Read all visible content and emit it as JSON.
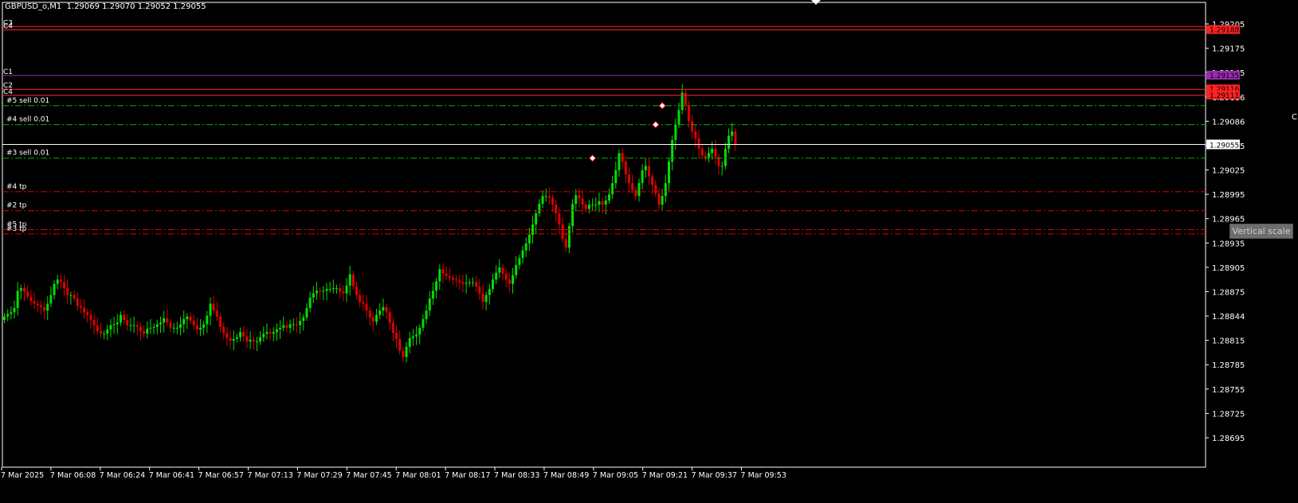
{
  "title": "GBPUSD_o,M1  1.29069 1.29070 1.29052 1.29055",
  "tooltip": "Vertical scale",
  "edge_button_glyph": "C",
  "colors": {
    "background": "#000000",
    "frame": "#ffffff",
    "bull": "#00e000",
    "bear": "#e00000",
    "level_red": "#ff2222",
    "level_purple": "#9a2bb0",
    "sell_line": "#00b300",
    "tp_line": "#e00000",
    "bid_line": "#ffffff",
    "grid_text": "#ffffff"
  },
  "chart_data": {
    "type": "candlestick",
    "symbol": "GBPUSD_o",
    "timeframe": "M1",
    "ohlc_last": {
      "open": 1.29069,
      "high": 1.2907,
      "low": 1.29052,
      "close": 1.29055
    },
    "ylim": [
      1.2868,
      1.2922
    ],
    "price_ticks": [
      "1.29205",
      "1.29175",
      "1.29145",
      "1.29116",
      "1.29086",
      "1.29055",
      "1.29025",
      "1.28995",
      "1.28965",
      "1.28935",
      "1.28905",
      "1.28875",
      "1.28844",
      "1.28815",
      "1.28785",
      "1.28755",
      "1.28725",
      "1.28695"
    ],
    "time_ticks": [
      "7 Mar 2025",
      "7 Mar 06:08",
      "7 Mar 06:24",
      "7 Mar 06:41",
      "7 Mar 06:57",
      "7 Mar 07:13",
      "7 Mar 07:29",
      "7 Mar 07:45",
      "7 Mar 08:01",
      "7 Mar 08:17",
      "7 Mar 08:33",
      "7 Mar 08:49",
      "7 Mar 09:05",
      "7 Mar 09:21",
      "7 Mar 09:37",
      "7 Mar 09:53"
    ],
    "bid": {
      "price": 1.29055,
      "label": "1.29055"
    },
    "levels": [
      {
        "name": "C3",
        "price": 1.29192,
        "color": "red"
      },
      {
        "name": "C4",
        "price": 1.29188,
        "color": "red",
        "tag": "1.29188"
      },
      {
        "name": "C1",
        "price": 1.29135,
        "color": "purple",
        "tag": "1.29135"
      },
      {
        "name": "C2",
        "price": 1.29119,
        "color": "red",
        "tag": "1.29116"
      },
      {
        "name": "C4",
        "price": 1.29112,
        "color": "red",
        "tag": "1.29111"
      }
    ],
    "orders": [
      {
        "label": "#5 sell 0.01",
        "price": 1.291
      },
      {
        "label": "#4 sell 0.01",
        "price": 1.29078
      },
      {
        "label": "#3 sell 0.01",
        "price": 1.29039
      }
    ],
    "take_profits": [
      {
        "label": "#4 tp",
        "price": 1.29
      },
      {
        "label": "#2 tp",
        "price": 1.28978
      },
      {
        "label": "#5 tp",
        "price": 1.28956
      },
      {
        "label": "#3 tp",
        "price": 1.28951
      }
    ],
    "entries": [
      {
        "index": 177,
        "price": 1.29039
      },
      {
        "index": 196,
        "price": 1.29078
      },
      {
        "index": 198,
        "price": 1.291
      }
    ],
    "closes": [
      1.28855,
      1.28858,
      1.2886,
      1.28865,
      1.28885,
      1.28888,
      1.28884,
      1.28878,
      1.28873,
      1.2887,
      1.28868,
      1.28866,
      1.28862,
      1.2887,
      1.2888,
      1.28893,
      1.28898,
      1.28895,
      1.28888,
      1.2888,
      1.2888,
      1.28876,
      1.28867,
      1.28865,
      1.2886,
      1.28857,
      1.28851,
      1.28845,
      1.28838,
      1.28835,
      1.28835,
      1.2884,
      1.28845,
      1.28846,
      1.28848,
      1.28857,
      1.28851,
      1.28845,
      1.28845,
      1.28845,
      1.28843,
      1.28838,
      1.28835,
      1.28841,
      1.28842,
      1.28843,
      1.28846,
      1.28848,
      1.28853,
      1.28848,
      1.28842,
      1.28842,
      1.28842,
      1.28846,
      1.28852,
      1.28855,
      1.2885,
      1.28845,
      1.2884,
      1.28842,
      1.28846,
      1.28856,
      1.2887,
      1.28862,
      1.28855,
      1.28843,
      1.28836,
      1.2883,
      1.28827,
      1.28829,
      1.28831,
      1.28837,
      1.28832,
      1.28826,
      1.28828,
      1.28826,
      1.28826,
      1.28831,
      1.28835,
      1.28837,
      1.28835,
      1.28837,
      1.2884,
      1.28842,
      1.28845,
      1.28842,
      1.28846,
      1.28846,
      1.28845,
      1.2885,
      1.28854,
      1.28865,
      1.28877,
      1.28882,
      1.28885,
      1.28884,
      1.28885,
      1.28887,
      1.28887,
      1.28888,
      1.28888,
      1.28884,
      1.28882,
      1.28891,
      1.28904,
      1.2889,
      1.2888,
      1.28872,
      1.2887,
      1.28862,
      1.28854,
      1.28849,
      1.28857,
      1.28862,
      1.28866,
      1.2886,
      1.28848,
      1.28836,
      1.28829,
      1.28815,
      1.28808,
      1.2882,
      1.2883,
      1.28832,
      1.28834,
      1.28842,
      1.28852,
      1.28862,
      1.28876,
      1.28885,
      1.28896,
      1.2891,
      1.28905,
      1.28902,
      1.289,
      1.28898,
      1.28897,
      1.28895,
      1.28893,
      1.28894,
      1.28895,
      1.28895,
      1.2889,
      1.28882,
      1.28872,
      1.2888,
      1.28887,
      1.28898,
      1.28906,
      1.28912,
      1.28905,
      1.28898,
      1.28893,
      1.28903,
      1.28915,
      1.28923,
      1.28932,
      1.2894,
      1.2895,
      1.28962,
      1.28975,
      1.28986,
      1.28995,
      1.28995,
      1.28993,
      1.28985,
      1.28975,
      1.28962,
      1.28945,
      1.28935,
      1.2896,
      1.28986,
      1.28996,
      1.28992,
      1.28985,
      1.2898,
      1.28985,
      1.28985,
      1.28985,
      1.28989,
      1.28985,
      1.2899,
      1.28997,
      1.2901,
      1.29025,
      1.29045,
      1.29035,
      1.2902,
      1.2901,
      1.29002,
      1.28995,
      1.2901,
      1.29025,
      1.2903,
      1.29018,
      1.29008,
      1.28998,
      1.28985,
      1.28995,
      1.2901,
      1.29035,
      1.2906,
      1.29078,
      1.29095,
      1.29115,
      1.291,
      1.29082,
      1.2907,
      1.29062,
      1.2905,
      1.29042,
      1.2904,
      1.29045,
      1.2905,
      1.2904,
      1.2903,
      1.2903,
      1.2905,
      1.29065,
      1.2907,
      1.29055
    ]
  }
}
